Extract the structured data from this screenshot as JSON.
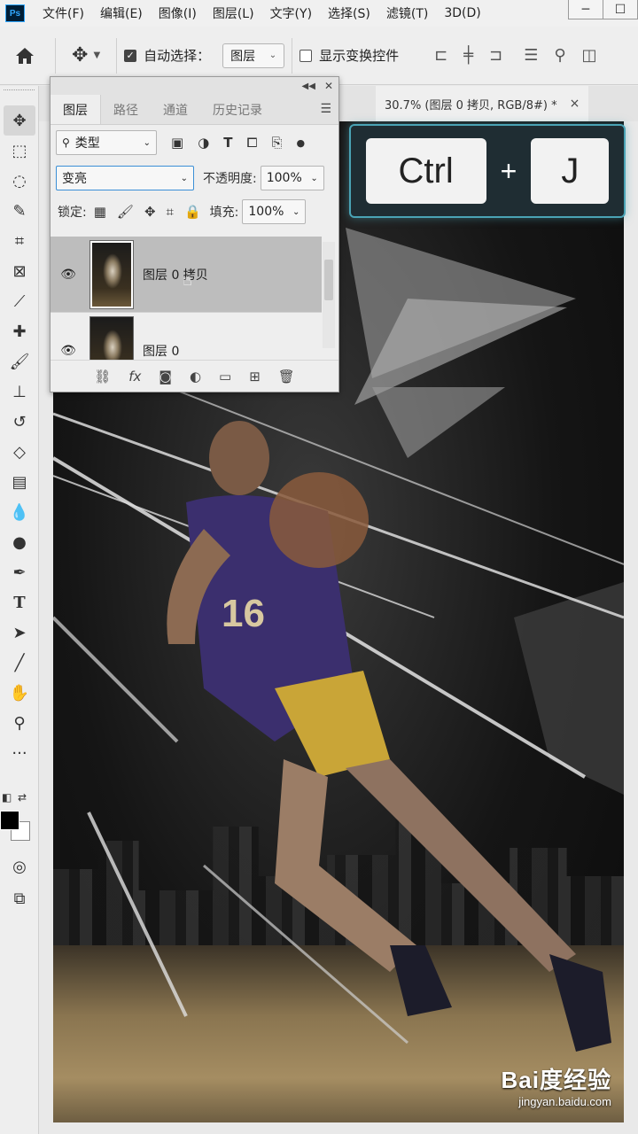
{
  "app": {
    "logo": "Ps"
  },
  "menu": [
    "文件(F)",
    "编辑(E)",
    "图像(I)",
    "图层(L)",
    "文字(Y)",
    "选择(S)",
    "滤镜(T)",
    "3D(D)"
  ],
  "window_buttons": {
    "minimize": "─",
    "maximize": "☐"
  },
  "options": {
    "auto_select_label": "自动选择：",
    "auto_select_checked": true,
    "auto_select_target": "图层",
    "show_transform_label": "显示变换控件",
    "show_transform_checked": false
  },
  "document_tab": {
    "title": "30.7% (图层 0 拷贝, RGB/8#) *",
    "close": "×"
  },
  "layers_panel": {
    "tabs": [
      "图层",
      "路径",
      "通道",
      "历史记录"
    ],
    "active_tab": "图层",
    "filter_label": "类型",
    "blend_mode": "变亮",
    "opacity_label": "不透明度:",
    "opacity_value": "100%",
    "lock_label": "锁定:",
    "fill_label": "填充:",
    "fill_value": "100%",
    "layers": [
      {
        "name": "图层 0 拷贝",
        "selected": true
      },
      {
        "name": "图层 0",
        "selected": false
      }
    ]
  },
  "shortcut": {
    "key1": "Ctrl",
    "plus": "+",
    "key2": "J"
  },
  "watermark": {
    "logo": "Bai度经验",
    "url": "jingyan.baidu.com"
  },
  "colors": {
    "accent": "#3b8fd6",
    "overlay_border": "#4aa3b5",
    "foreground": "#000000",
    "background": "#ffffff"
  }
}
